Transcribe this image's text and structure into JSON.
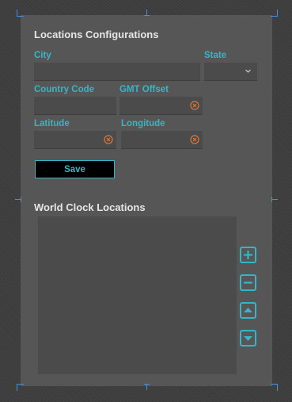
{
  "config": {
    "title": "Locations Configurations",
    "city": {
      "label": "City",
      "value": ""
    },
    "state": {
      "label": "State",
      "value": ""
    },
    "country_code": {
      "label": "Country Code",
      "value": ""
    },
    "gmt_offset": {
      "label": "GMT Offset",
      "value": ""
    },
    "latitude": {
      "label": "Latitude",
      "value": ""
    },
    "longitude": {
      "label": "Longitude",
      "value": ""
    },
    "save_label": "Save"
  },
  "world_clock": {
    "title": "World Clock Locations",
    "items": [],
    "buttons": [
      "add-icon",
      "remove-icon",
      "move-up-icon",
      "move-down-icon"
    ]
  },
  "colors": {
    "accent": "#35b6c6",
    "clear_icon": "#d9773a",
    "panel": "#565656",
    "field": "#4b4b4b"
  }
}
